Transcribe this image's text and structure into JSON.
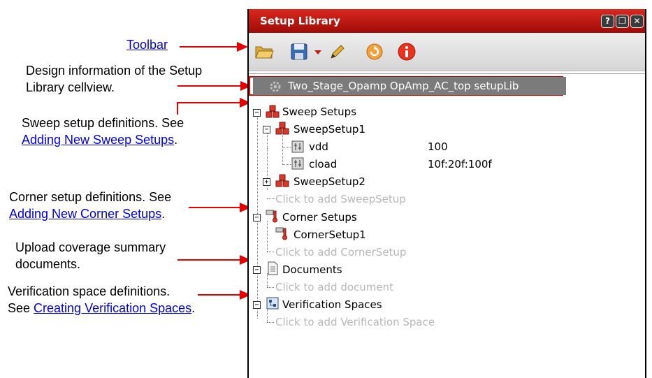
{
  "annotations": {
    "toolbar": "Toolbar",
    "design_info_1": "Design information of the Setup",
    "design_info_2": "Library cellview.",
    "sweep_1": "Sweep setup definitions. See",
    "sweep_link": "Adding New Sweep Setups",
    "sweep_period": ".",
    "corner_1": "Corner setup definitions. See",
    "corner_link": "Adding New Corner Setups",
    "corner_period": ".",
    "upload_1": "Upload coverage summary",
    "upload_2": "documents.",
    "verif_1": "Verification space definitions.",
    "verif_see": "See ",
    "verif_link": "Creating Verification Spaces",
    "verif_period": "."
  },
  "panel": {
    "title": "Setup Library",
    "title_buttons": [
      "?",
      "❐",
      "✕"
    ],
    "toolbar_icons": [
      "open-folder-icon",
      "save-icon",
      "dropdown-arrow-icon",
      "pencil-icon",
      "refresh-icon",
      "info-icon"
    ]
  },
  "tree": {
    "root": "Two_Stage_Opamp OpAmp_AC_top setupLib",
    "sweep_setups": "Sweep Setups",
    "sweep_setup1": "SweepSetup1",
    "vdd_name": "vdd",
    "vdd_value": "100",
    "cload_name": "cload",
    "cload_value": "10f:20f:100f",
    "sweep_setup2": "SweepSetup2",
    "add_sweep": "Click to add SweepSetup",
    "corner_setups": "Corner Setups",
    "corner_setup1": "CornerSetup1",
    "add_corner": "Click to add CornerSetup",
    "documents": "Documents",
    "add_document": "Click to add document",
    "verification_spaces": "Verification Spaces",
    "add_verification": "Click to add Verification Space"
  },
  "colors": {
    "accent_red": "#e60000",
    "title_bar": "#c0180f",
    "link": "#0000ee",
    "placeholder": "#b8b8b8"
  }
}
